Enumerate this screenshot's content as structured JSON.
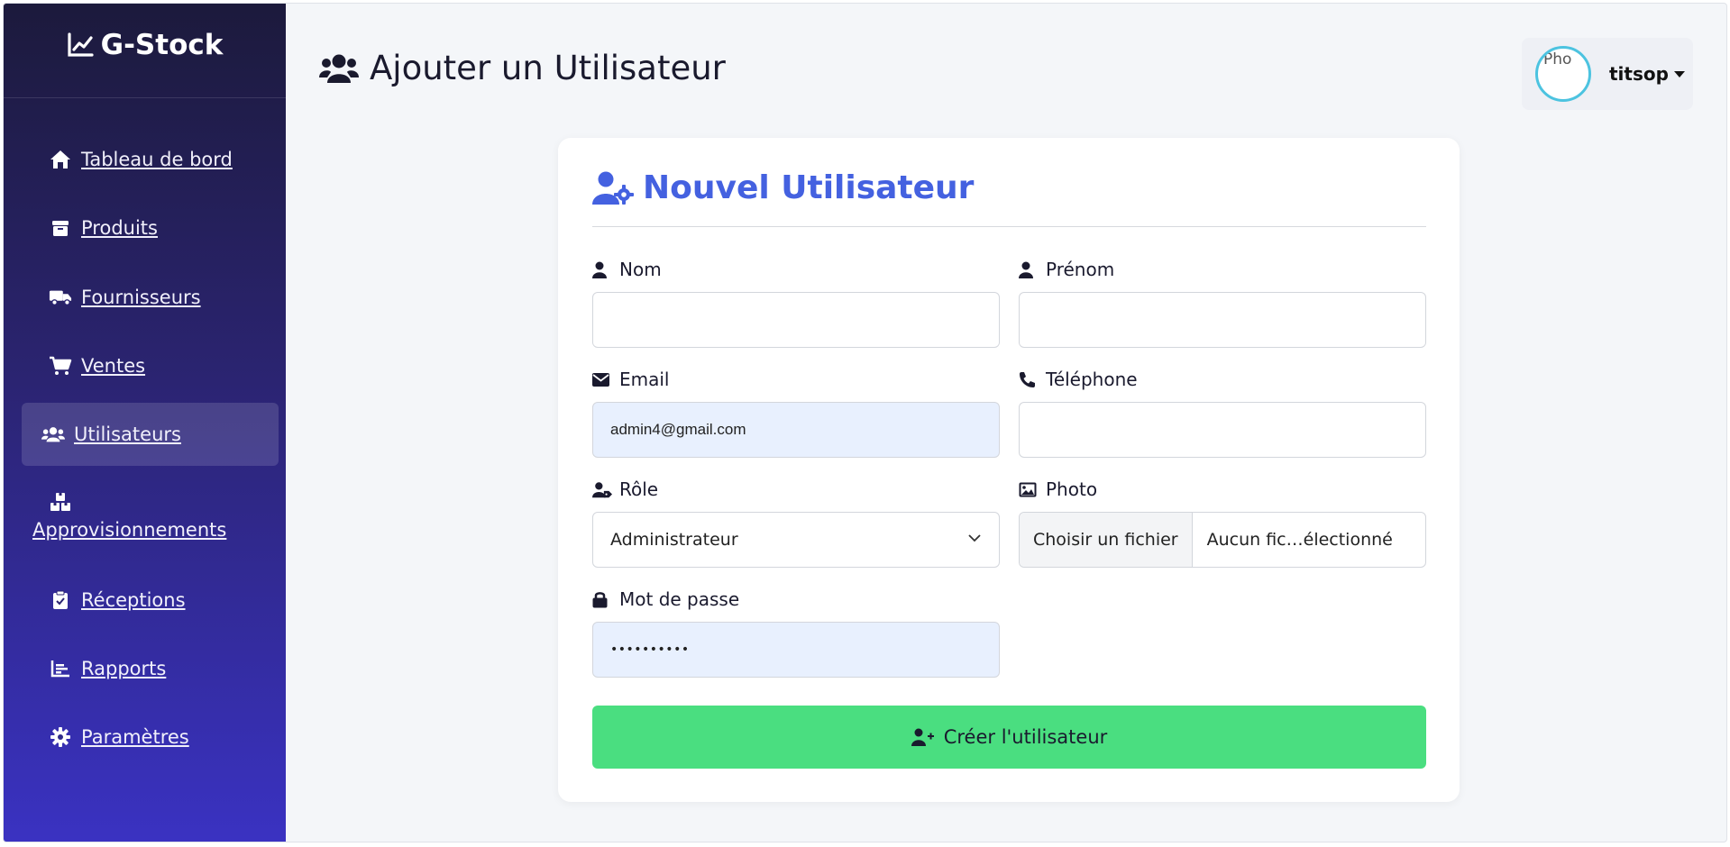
{
  "app": {
    "brand": "G-Stock"
  },
  "sidebar": {
    "items": [
      {
        "label": "Tableau de bord",
        "icon": "home-icon"
      },
      {
        "label": "Produits",
        "icon": "box-icon"
      },
      {
        "label": "Fournisseurs",
        "icon": "truck-icon"
      },
      {
        "label": "Ventes",
        "icon": "cart-icon"
      },
      {
        "label": "Utilisateurs",
        "icon": "users-icon",
        "active": true
      },
      {
        "label": "Approvisionnements",
        "icon": "boxes-icon"
      },
      {
        "label": "Réceptions",
        "icon": "clipboard-check-icon"
      },
      {
        "label": "Rapports",
        "icon": "chart-bar-icon"
      },
      {
        "label": "Paramètres",
        "icon": "gear-icon"
      }
    ]
  },
  "header": {
    "title": "Ajouter un Utilisateur",
    "user": {
      "avatar_alt": "Pho",
      "name": "titsop"
    }
  },
  "form": {
    "title": "Nouvel Utilisateur",
    "nom": {
      "label": "Nom",
      "value": ""
    },
    "prenom": {
      "label": "Prénom",
      "value": ""
    },
    "email": {
      "label": "Email",
      "value": "admin4@gmail.com"
    },
    "telephone": {
      "label": "Téléphone",
      "value": ""
    },
    "role": {
      "label": "Rôle",
      "selected": "Administrateur"
    },
    "photo": {
      "label": "Photo",
      "button": "Choisir un fichier",
      "file": "Aucun fic…électionné"
    },
    "password": {
      "label": "Mot de passe",
      "value": "••••••••••"
    },
    "submit": "Créer l'utilisateur"
  },
  "colors": {
    "accent": "#4461e0",
    "submit": "#4ade80",
    "sidebar_top": "#1c1a3c",
    "sidebar_bottom": "#3a32c2",
    "autofill": "#e8f0fe"
  }
}
